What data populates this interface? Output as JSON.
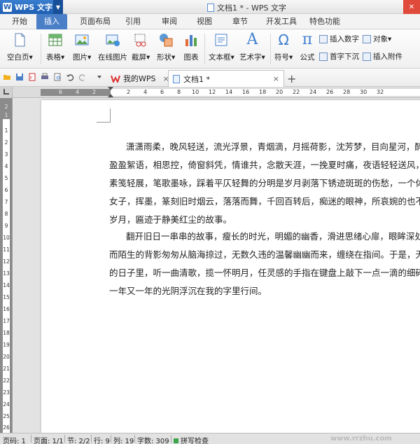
{
  "titlebar": {
    "app_button": "WPS 文字",
    "app_logo": "W",
    "window_title": "文档1 * - WPS 文字"
  },
  "menu": {
    "tabs": [
      "开始",
      "插入",
      "页面布局",
      "引用",
      "审阅",
      "视图",
      "章节",
      "开发工具",
      "特色功能"
    ],
    "active": "插入"
  },
  "ribbon": {
    "blank_page": "空白页",
    "table": "表格",
    "picture": "图片",
    "online_picture": "在线图片",
    "screenshot": "截屏",
    "shape": "形状",
    "chart": "图表",
    "textbox": "文本框",
    "wordart": "艺术字",
    "symbol": "符号",
    "formula": "公式",
    "insert_number": "插入数字",
    "object": "对象",
    "drop_cap": "首字下沉",
    "insert_attachment": "插入附件",
    "formula_glyph": "π",
    "omega_glyph": "Ω",
    "wordart_glyph": "A",
    "dropdown_glyph": "▾"
  },
  "doc_tabs": {
    "tab1": "我的WPS",
    "tab2": "文档1 *",
    "close": "×",
    "new": "+"
  },
  "ruler": {
    "top_numbers": [
      "6",
      "4",
      "2",
      "2",
      "4",
      "6",
      "8",
      "10",
      "12",
      "14",
      "16",
      "18",
      "20",
      "22",
      "24",
      "26",
      "28",
      "30",
      "32"
    ],
    "left_numbers": [
      "2",
      "1",
      "1",
      "2",
      "3",
      "4",
      "5",
      "6",
      "7",
      "8",
      "9",
      "10",
      "11",
      "12",
      "13",
      "14",
      "15",
      "16",
      "17",
      "18",
      "19",
      "20",
      "21",
      "22",
      "23",
      "24",
      "25",
      "26"
    ]
  },
  "document": {
    "para1": [
      "潇潇雨柔，晚风轻送，流光浮景，青烟滴，月摇荷影，沈芳梦，目向星河，醉把清音",
      "盈盈絮语，相思控，倚窗斜凭，情谁共，念散天涯，一挽夏时痛，夜语轻轻送风，柔情",
      "素笺轻展，笔歌墨咏，踩着平仄轻舞的分明是岁月剥落下锈迹斑斑的伤愁，一个体弱多病",
      "女子，挥墨，篆刻旧时烟云，落落而舞，千回百转后，痴迷的眼神，所哀婉的也不过是",
      "岁月，匾迹于静美红尘的故事。"
    ],
    "para2": [
      "翻开旧日一串串的故事，瘦长的时光，明媚的幽香，滑进思绪心扉，眼眸深处，那耶",
      "而陌生的背影匆匆从脑海掠过，无数久违的温馨幽幽而来，缠绕在指间。于是，无数个回",
      "的日子里，听一曲清歌，揽一怀明月，任灵感的手指在键盘上敲下一点一滴的细碎心情，",
      "一年又一年的光阴浮沉在我的字里行间。"
    ]
  },
  "statusbar": {
    "page_code": "页码: 1",
    "page": "页面: 1/1",
    "section": "节: 2/2",
    "row": "行: 9",
    "column": "列: 19",
    "word_count": "字数: 309",
    "spell_check": "拼写检查",
    "watermark": "www.rrzhu.com"
  }
}
